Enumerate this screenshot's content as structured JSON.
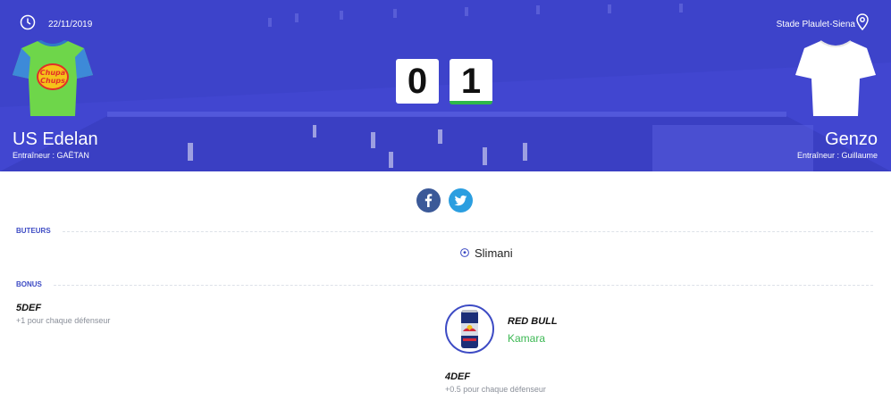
{
  "match": {
    "date": "22/11/2019",
    "stadium": "Stade Plaulet-Siena",
    "home": {
      "name": "US Edelan",
      "coach": "Entraîneur : GAËTAN",
      "score": "0",
      "sponsor": "Chupa Chups"
    },
    "away": {
      "name": "Genzo",
      "coach": "Entraîneur : Guillaume",
      "score": "1"
    }
  },
  "sections": {
    "scorers_label": "BUTEURS",
    "bonus_label": "BONUS"
  },
  "scorers": [
    {
      "name": "Slimani",
      "side": "away"
    }
  ],
  "bonuses": {
    "home": [
      {
        "name": "5DEF",
        "desc": "+1 pour chaque défenseur"
      }
    ],
    "away": [
      {
        "name": "RED BULL",
        "player": "Kamara",
        "icon": "red-bull-can-icon"
      },
      {
        "name": "4DEF",
        "desc": "+0.5 pour chaque défenseur"
      }
    ]
  },
  "colors": {
    "accent": "#3d4bc4",
    "hero": "#4046cf",
    "success": "#3cb853",
    "facebook": "#3b5998",
    "twitter": "#2b9ee0"
  }
}
